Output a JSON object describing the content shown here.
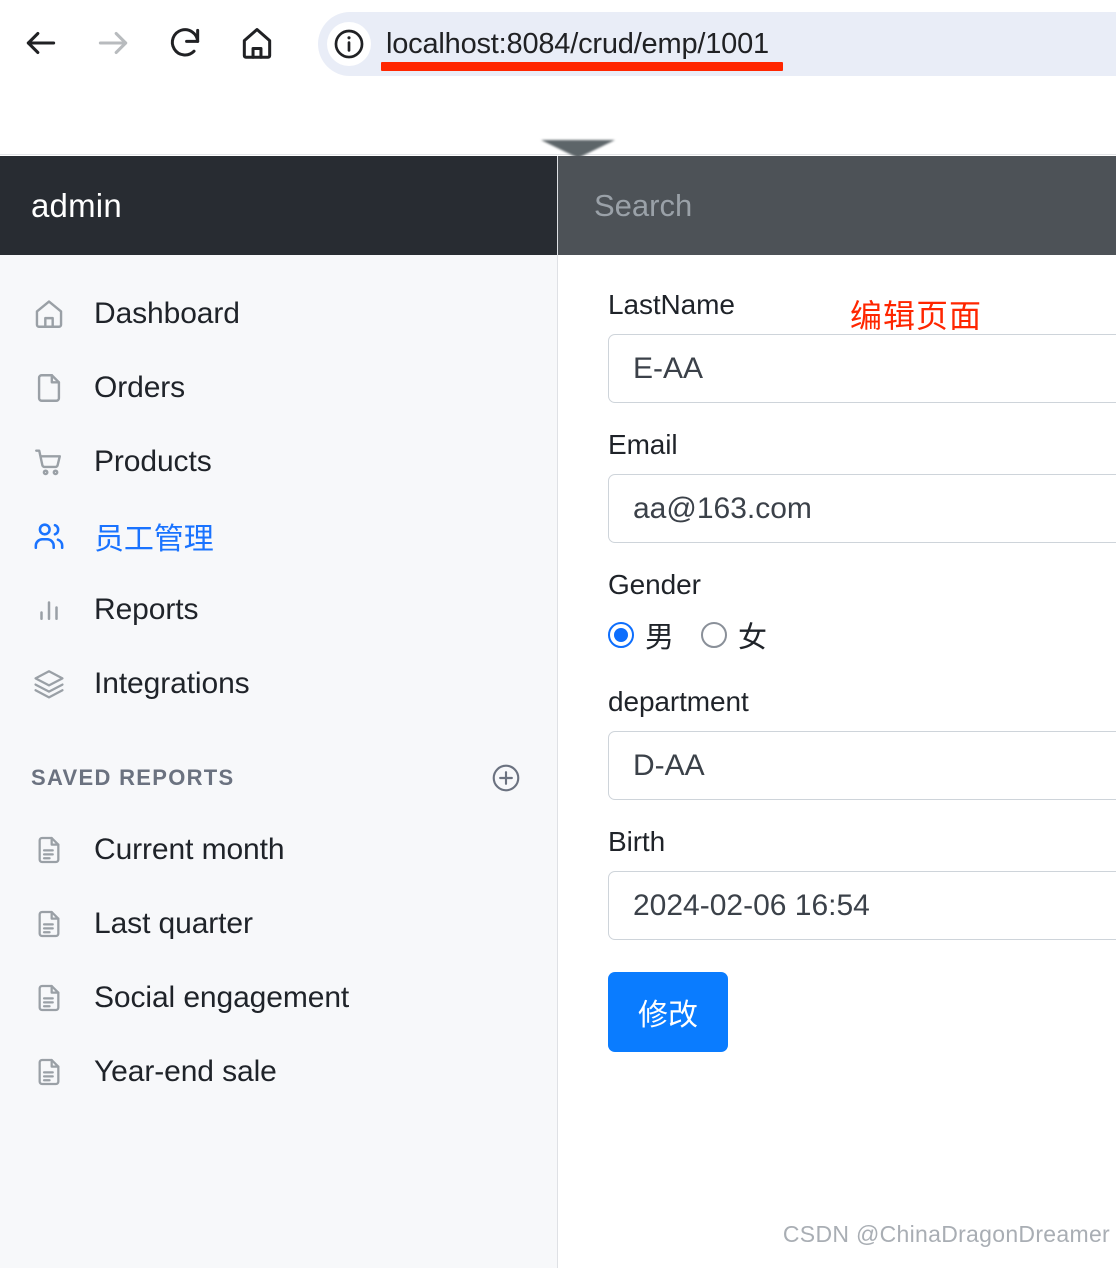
{
  "browser": {
    "back_icon": "arrow-left-icon",
    "forward_icon": "arrow-right-icon",
    "reload_icon": "reload-icon",
    "home_icon": "home-icon",
    "site_info_icon": "info-circle-icon",
    "url": "localhost:8084/crud/emp/1001",
    "url_underline_color": "#ff2600"
  },
  "sidebar": {
    "brand": "admin",
    "items": [
      {
        "label": "Dashboard",
        "icon": "home-icon",
        "active": false
      },
      {
        "label": "Orders",
        "icon": "file-icon",
        "active": false
      },
      {
        "label": "Products",
        "icon": "cart-icon",
        "active": false
      },
      {
        "label": "员工管理",
        "icon": "users-icon",
        "active": true
      },
      {
        "label": "Reports",
        "icon": "bar-chart-icon",
        "active": false
      },
      {
        "label": "Integrations",
        "icon": "layers-icon",
        "active": false
      }
    ],
    "saved_reports": {
      "title": "SAVED REPORTS",
      "add_icon": "plus-circle-icon",
      "items": [
        {
          "label": "Current month",
          "icon": "document-icon"
        },
        {
          "label": "Last quarter",
          "icon": "document-icon"
        },
        {
          "label": "Social engagement",
          "icon": "document-icon"
        },
        {
          "label": "Year-end sale",
          "icon": "document-icon"
        }
      ]
    },
    "header_bg": "#282c32",
    "body_bg": "#f7f8fa",
    "active_color": "#1a73ff"
  },
  "content": {
    "search_placeholder": "Search",
    "search_value": "",
    "search_header_bg": "#4d5257",
    "annotation": "编辑页面",
    "annotation_color": "#ff2600",
    "form": {
      "lastname": {
        "label": "LastName",
        "value": "E-AA"
      },
      "email": {
        "label": "Email",
        "value": "aa@163.com"
      },
      "gender": {
        "label": "Gender",
        "options": [
          {
            "label": "男",
            "checked": true
          },
          {
            "label": "女",
            "checked": false
          }
        ]
      },
      "department": {
        "label": "department",
        "value": "D-AA"
      },
      "birth": {
        "label": "Birth",
        "value": "2024-02-06 16:54"
      },
      "submit_label": "修改",
      "submit_color": "#0a7cff"
    },
    "watermark": "CSDN @ChinaDragonDreamer"
  }
}
